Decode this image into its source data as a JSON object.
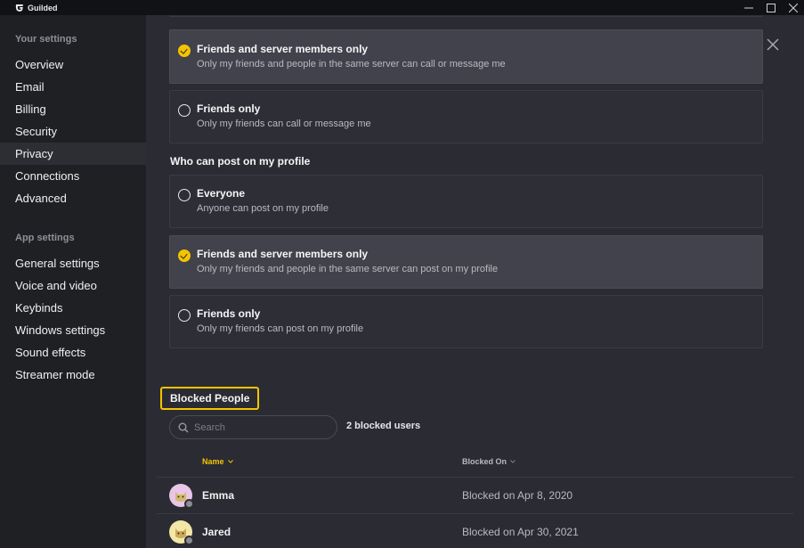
{
  "app": {
    "name": "Guilded"
  },
  "sidebar": {
    "your_settings_heading": "Your settings",
    "your_settings": [
      {
        "label": "Overview"
      },
      {
        "label": "Email"
      },
      {
        "label": "Billing"
      },
      {
        "label": "Security"
      },
      {
        "label": "Privacy",
        "active": true
      },
      {
        "label": "Connections"
      },
      {
        "label": "Advanced"
      }
    ],
    "app_settings_heading": "App settings",
    "app_settings": [
      {
        "label": "General settings"
      },
      {
        "label": "Voice and video"
      },
      {
        "label": "Keybinds"
      },
      {
        "label": "Windows settings"
      },
      {
        "label": "Sound effects"
      },
      {
        "label": "Streamer mode"
      }
    ]
  },
  "call_message": {
    "options": [
      {
        "title": "Friends and server members only",
        "desc": "Only my friends and people in the same server can call or message me",
        "selected": true
      },
      {
        "title": "Friends only",
        "desc": "Only my friends can call or message me",
        "selected": false
      }
    ]
  },
  "profile_post": {
    "heading": "Who can post on my profile",
    "options": [
      {
        "title": "Everyone",
        "desc": "Anyone can post on my profile",
        "selected": false
      },
      {
        "title": "Friends and server members only",
        "desc": "Only my friends and people in the same server can post on my profile",
        "selected": true
      },
      {
        "title": "Friends only",
        "desc": "Only my friends can post on my profile",
        "selected": false
      }
    ]
  },
  "blocked": {
    "title": "Blocked People",
    "search_placeholder": "Search",
    "count": "2 blocked users",
    "columns": {
      "name": "Name",
      "blocked_on": "Blocked On"
    },
    "rows": [
      {
        "name": "Emma",
        "date": "Blocked on Apr 8, 2020",
        "avatar_bg": "#e9c6e8"
      },
      {
        "name": "Jared",
        "date": "Blocked on Apr 30, 2021",
        "avatar_bg": "#f3e7a7"
      }
    ]
  },
  "colors": {
    "accent": "#f5c400",
    "sidebar_bg": "#1f2024",
    "content_bg": "#2b2c33"
  }
}
